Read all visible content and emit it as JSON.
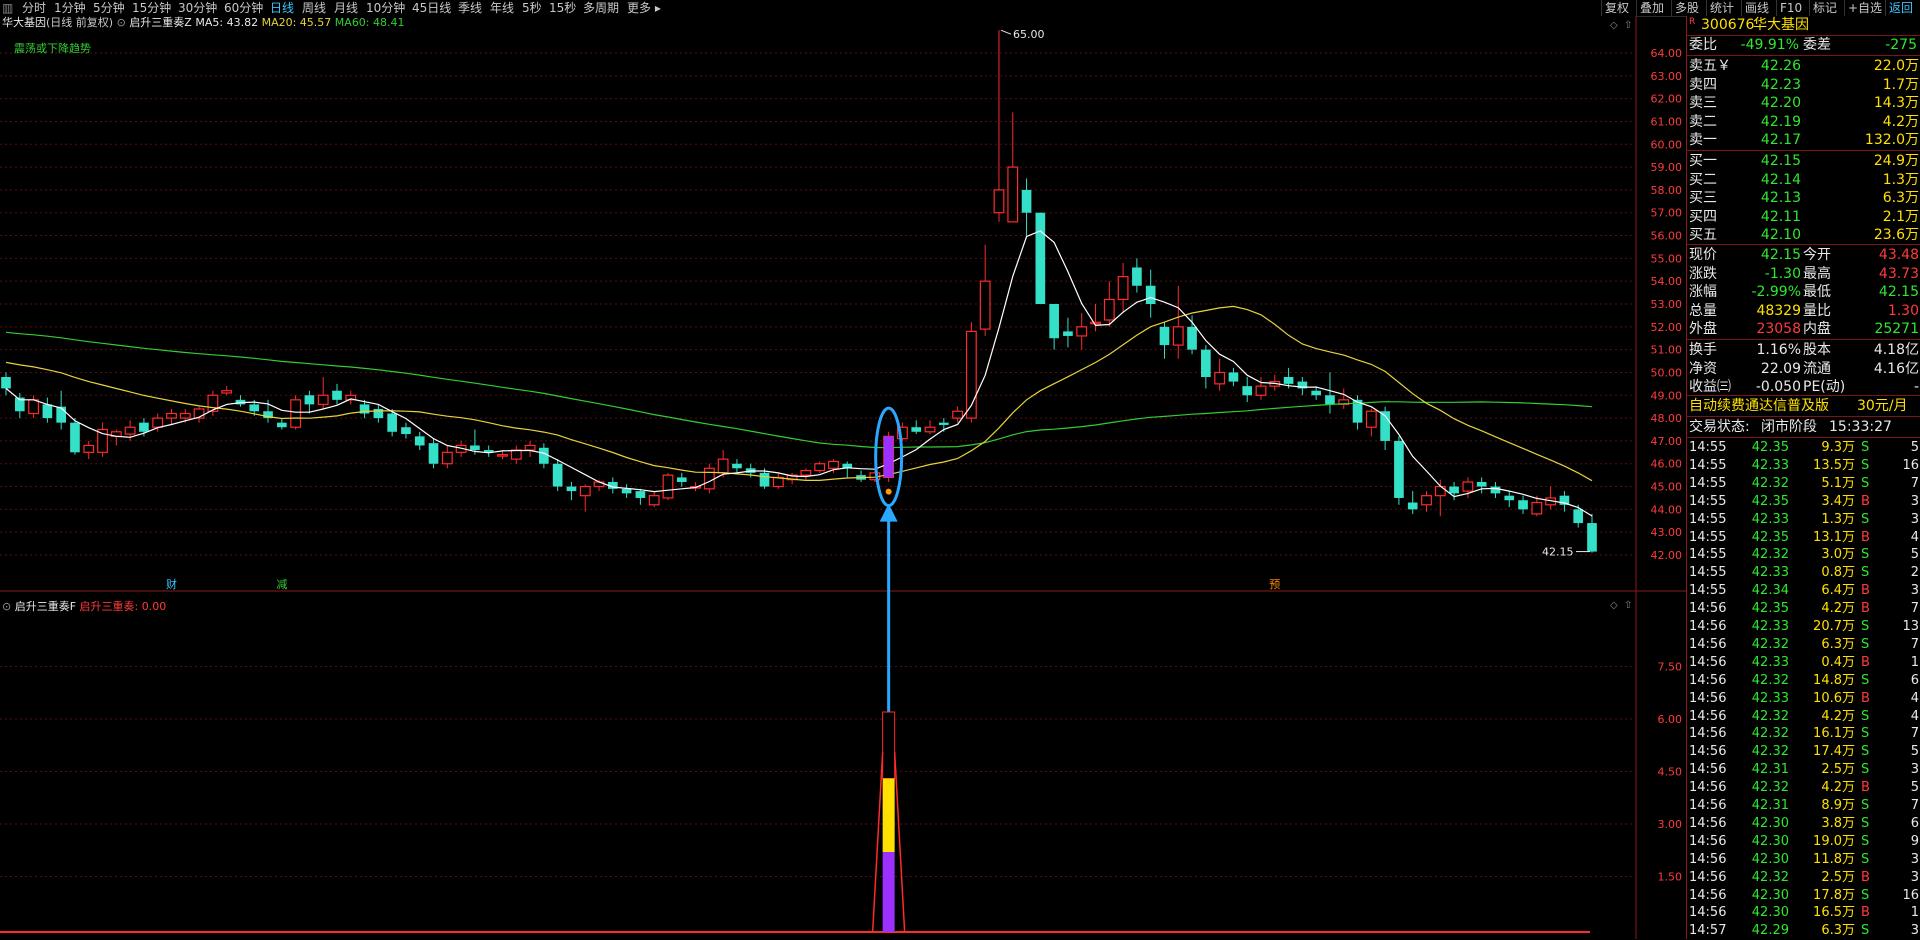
{
  "toolbar": {
    "left_items": [
      {
        "label": "分时",
        "active": false
      },
      {
        "label": "1分钟",
        "active": false
      },
      {
        "label": "5分钟",
        "active": false
      },
      {
        "label": "15分钟",
        "active": false
      },
      {
        "label": "30分钟",
        "active": false
      },
      {
        "label": "60分钟",
        "active": false
      },
      {
        "label": "日线",
        "active": true
      },
      {
        "label": "周线",
        "active": false
      },
      {
        "label": "月线",
        "active": false
      },
      {
        "label": "10分钟",
        "active": false
      },
      {
        "label": "45日线",
        "active": false
      },
      {
        "label": "季线",
        "active": false
      },
      {
        "label": "年线",
        "active": false
      },
      {
        "label": "5秒",
        "active": false
      },
      {
        "label": "15秒",
        "active": false
      },
      {
        "label": "多周期",
        "active": false
      },
      {
        "label": "更多",
        "active": false
      }
    ],
    "right_items": [
      {
        "label": "复权"
      },
      {
        "label": "叠加"
      },
      {
        "label": "多股"
      },
      {
        "label": "统计"
      },
      {
        "label": "画线"
      },
      {
        "label": "F10"
      },
      {
        "label": "标记"
      },
      {
        "label": "+自选"
      },
      {
        "label": "返回"
      }
    ]
  },
  "chart_header": {
    "stock_name": "华大基因",
    "period_label": "(日线 前复权)",
    "indicator_name": "启升三重奏Z",
    "ma5": "MA5: 43.82",
    "ma20": "MA20: 45.57",
    "ma60": "MA60: 48.41",
    "trend_text": "震荡或下降趋势",
    "max_label": "65.00",
    "last_label": "42.15",
    "markers": [
      "财",
      "减",
      "预"
    ]
  },
  "sub_header": {
    "indicator_name": "启升三重奏F",
    "indicator_value": "启升三重奏: 0.00"
  },
  "colors": {
    "up": "#ff2a2a",
    "down": "#35e0c8",
    "ma5": "#ffffff",
    "ma20": "#e6d23c",
    "ma60": "#33cc33",
    "grid": "#5a0f0f",
    "annotation": "#2aa8ff"
  },
  "chart_data": {
    "type": "candlestick",
    "price_axis": {
      "min": 42.0,
      "max": 64.0,
      "ticks": [
        "64.00",
        "63.00",
        "62.00",
        "61.00",
        "60.00",
        "59.00",
        "58.00",
        "57.00",
        "56.00",
        "55.00",
        "54.00",
        "53.00",
        "52.00",
        "51.00",
        "50.00",
        "49.00",
        "48.00",
        "47.00",
        "46.00",
        "45.00",
        "44.00",
        "43.00",
        "42.00"
      ]
    },
    "candles": [
      [
        49.8,
        49.3,
        50.0,
        49.0
      ],
      [
        48.9,
        48.3,
        49.1,
        48.0
      ],
      [
        48.2,
        48.8,
        49.0,
        48.0
      ],
      [
        48.6,
        48.0,
        48.9,
        47.8
      ],
      [
        48.5,
        47.8,
        49.2,
        47.5
      ],
      [
        47.8,
        46.5,
        48.0,
        46.4
      ],
      [
        46.5,
        46.8,
        47.0,
        46.2
      ],
      [
        46.5,
        47.5,
        47.8,
        46.3
      ],
      [
        47.2,
        47.4,
        47.5,
        46.8
      ],
      [
        47.3,
        47.6,
        47.9,
        47.0
      ],
      [
        47.8,
        47.4,
        48.0,
        47.2
      ],
      [
        47.6,
        48.0,
        48.2,
        47.4
      ],
      [
        48.0,
        48.2,
        48.4,
        47.7
      ],
      [
        48.0,
        48.2,
        48.4,
        47.8
      ],
      [
        48.0,
        48.4,
        48.5,
        47.8
      ],
      [
        48.3,
        49.0,
        49.2,
        48.1
      ],
      [
        49.1,
        49.2,
        49.4,
        49.0
      ],
      [
        48.8,
        48.6,
        49.0,
        48.5
      ],
      [
        48.6,
        48.3,
        48.8,
        48.1
      ],
      [
        48.3,
        48.0,
        48.8,
        47.8
      ],
      [
        47.8,
        47.6,
        48.0,
        47.5
      ],
      [
        47.6,
        48.8,
        49.0,
        47.5
      ],
      [
        49.0,
        48.6,
        49.2,
        48.2
      ],
      [
        48.6,
        49.0,
        49.8,
        48.4
      ],
      [
        49.2,
        48.8,
        49.5,
        48.6
      ],
      [
        48.8,
        49.0,
        49.2,
        48.6
      ],
      [
        48.6,
        48.2,
        48.8,
        48.0
      ],
      [
        48.4,
        48.0,
        48.6,
        47.8
      ],
      [
        48.2,
        47.4,
        48.4,
        47.2
      ],
      [
        47.6,
        47.3,
        47.8,
        47.1
      ],
      [
        47.2,
        46.8,
        47.4,
        46.6
      ],
      [
        46.9,
        46.0,
        47.1,
        45.8
      ],
      [
        46.0,
        46.5,
        46.8,
        45.8
      ],
      [
        46.5,
        46.8,
        47.0,
        46.3
      ],
      [
        46.8,
        46.6,
        47.5,
        46.4
      ],
      [
        46.6,
        46.5,
        46.8,
        46.3
      ],
      [
        46.4,
        46.4,
        46.6,
        46.2
      ],
      [
        46.2,
        46.6,
        46.8,
        46.0
      ],
      [
        46.6,
        46.8,
        47.0,
        46.3
      ],
      [
        46.7,
        46.0,
        46.9,
        45.8
      ],
      [
        46.0,
        45.0,
        46.2,
        44.8
      ],
      [
        45.0,
        44.8,
        45.2,
        44.4
      ],
      [
        44.6,
        45.0,
        45.1,
        43.9
      ],
      [
        45.0,
        45.2,
        45.3,
        44.8
      ],
      [
        45.2,
        44.9,
        45.4,
        44.7
      ],
      [
        44.9,
        44.7,
        45.1,
        44.5
      ],
      [
        44.8,
        44.5,
        44.9,
        44.2
      ],
      [
        44.2,
        44.6,
        44.8,
        44.1
      ],
      [
        44.5,
        45.5,
        45.6,
        44.4
      ],
      [
        45.4,
        45.2,
        45.6,
        45.0
      ],
      [
        45.0,
        45.0,
        45.2,
        44.8
      ],
      [
        44.9,
        45.8,
        46.0,
        44.7
      ],
      [
        45.6,
        46.2,
        46.6,
        45.4
      ],
      [
        46.0,
        45.8,
        46.2,
        45.6
      ],
      [
        45.8,
        45.6,
        46.0,
        45.4
      ],
      [
        45.6,
        45.0,
        45.8,
        44.9
      ],
      [
        45.0,
        45.4,
        45.6,
        44.9
      ],
      [
        45.3,
        45.5,
        45.6,
        45.1
      ],
      [
        45.5,
        45.7,
        45.8,
        45.3
      ],
      [
        45.7,
        46.0,
        46.1,
        45.6
      ],
      [
        45.8,
        46.1,
        46.2,
        45.6
      ],
      [
        46.0,
        45.8,
        46.1,
        45.4
      ],
      [
        45.5,
        45.3,
        45.7,
        45.2
      ],
      [
        45.3,
        45.6,
        45.7,
        45.2
      ],
      [
        45.4,
        47.2,
        47.4,
        45.2
      ],
      [
        47.1,
        47.6,
        47.8,
        47.0
      ],
      [
        47.6,
        47.4,
        47.9,
        47.3
      ],
      [
        47.4,
        47.6,
        47.9,
        47.3
      ],
      [
        47.8,
        47.7,
        48.0,
        47.4
      ],
      [
        48.0,
        48.3,
        48.5,
        47.8
      ],
      [
        48.0,
        51.8,
        52.2,
        47.8
      ],
      [
        51.9,
        54.0,
        55.6,
        51.6
      ],
      [
        57.0,
        58.0,
        65.0,
        56.6
      ],
      [
        56.6,
        59.0,
        61.4,
        56.6
      ],
      [
        58.0,
        57.0,
        58.5,
        56.0
      ],
      [
        57.0,
        53.0,
        57.0,
        53.0
      ],
      [
        53.0,
        51.5,
        53.0,
        51.0
      ],
      [
        51.8,
        51.6,
        52.4,
        51.1
      ],
      [
        51.6,
        52.0,
        52.6,
        51.0
      ],
      [
        52.2,
        52.2,
        53.0,
        51.8
      ],
      [
        52.3,
        53.2,
        54.0,
        52.0
      ],
      [
        53.2,
        54.2,
        54.8,
        52.6
      ],
      [
        54.6,
        53.8,
        55.0,
        53.5
      ],
      [
        53.8,
        53.0,
        54.5,
        52.4
      ],
      [
        52.0,
        51.2,
        52.2,
        50.6
      ],
      [
        51.2,
        52.0,
        53.8,
        50.6
      ],
      [
        52.0,
        51.0,
        52.5,
        50.8
      ],
      [
        51.0,
        49.8,
        51.2,
        49.3
      ],
      [
        49.5,
        50.0,
        50.6,
        49.2
      ],
      [
        50.0,
        49.6,
        50.2,
        49.4
      ],
      [
        49.4,
        49.0,
        49.8,
        48.7
      ],
      [
        49.0,
        49.4,
        49.8,
        48.8
      ],
      [
        49.4,
        49.6,
        49.9,
        49.2
      ],
      [
        49.8,
        49.5,
        50.2,
        49.3
      ],
      [
        49.6,
        49.3,
        49.8,
        49.0
      ],
      [
        49.2,
        49.0,
        49.4,
        48.8
      ],
      [
        49.0,
        48.6,
        50.0,
        48.2
      ],
      [
        48.6,
        48.8,
        49.3,
        48.4
      ],
      [
        48.8,
        47.8,
        49.0,
        47.5
      ],
      [
        47.6,
        48.3,
        48.4,
        47.2
      ],
      [
        48.3,
        47.0,
        48.5,
        46.6
      ],
      [
        47.0,
        44.5,
        47.2,
        44.2
      ],
      [
        44.3,
        44.0,
        44.8,
        43.8
      ],
      [
        44.2,
        44.6,
        44.8,
        43.9
      ],
      [
        44.6,
        45.0,
        45.3,
        43.7
      ],
      [
        45.0,
        44.7,
        45.2,
        44.4
      ],
      [
        44.8,
        45.2,
        45.4,
        44.5
      ],
      [
        45.2,
        45.0,
        45.4,
        44.7
      ],
      [
        45.0,
        44.7,
        45.2,
        44.5
      ],
      [
        44.6,
        44.4,
        44.8,
        44.1
      ],
      [
        44.4,
        44.0,
        44.6,
        43.8
      ],
      [
        43.8,
        44.3,
        44.6,
        43.7
      ],
      [
        44.2,
        44.5,
        45.0,
        44.0
      ],
      [
        44.6,
        44.2,
        44.8,
        43.9
      ],
      [
        44.0,
        43.4,
        44.2,
        43.2
      ],
      [
        43.4,
        42.15,
        43.8,
        42.1
      ]
    ],
    "sub_axis": {
      "ticks": [
        "7.50",
        "6.00",
        "4.50",
        "3.00",
        "1.50"
      ],
      "min": 0,
      "max": 9.0
    },
    "signal": {
      "candle_index": 64,
      "value_total": 6.2,
      "value_yellow": 4.3,
      "value_purple": 2.2
    }
  },
  "right_panel": {
    "code": "300676",
    "name": "华大基因",
    "rsi_tag": "R",
    "weibi": {
      "label": "委比",
      "value": "-49.91%",
      "label2": "委差",
      "value2": "-275"
    },
    "sell": [
      {
        "label": "卖五￥",
        "price": "42.26",
        "vol": "22.0万"
      },
      {
        "label": "卖四",
        "price": "42.23",
        "vol": "1.7万"
      },
      {
        "label": "卖三",
        "price": "42.20",
        "vol": "14.3万"
      },
      {
        "label": "卖二",
        "price": "42.19",
        "vol": "4.2万"
      },
      {
        "label": "卖一",
        "price": "42.17",
        "vol": "132.0万"
      }
    ],
    "buy": [
      {
        "label": "买一",
        "price": "42.15",
        "vol": "24.9万"
      },
      {
        "label": "买二",
        "price": "42.14",
        "vol": "1.3万"
      },
      {
        "label": "买三",
        "price": "42.13",
        "vol": "6.3万"
      },
      {
        "label": "买四",
        "price": "42.11",
        "vol": "2.1万"
      },
      {
        "label": "买五",
        "price": "42.10",
        "vol": "23.6万"
      }
    ],
    "quote": [
      {
        "l1": "现价",
        "v1": "42.15",
        "c1": "green",
        "l2": "今开",
        "v2": "43.48",
        "c2": "red"
      },
      {
        "l1": "涨跌",
        "v1": "-1.30",
        "c1": "green",
        "l2": "最高",
        "v2": "43.73",
        "c2": "red"
      },
      {
        "l1": "涨幅",
        "v1": "-2.99%",
        "c1": "green",
        "l2": "最低",
        "v2": "42.15",
        "c2": "green"
      },
      {
        "l1": "总量",
        "v1": "48329",
        "c1": "yellow",
        "l2": "量比",
        "v2": "1.30",
        "c2": "red"
      },
      {
        "l1": "外盘",
        "v1": "23058",
        "c1": "red",
        "l2": "内盘",
        "v2": "25271",
        "c2": "green"
      }
    ],
    "fund": [
      {
        "l1": "换手",
        "v1": "1.16%",
        "l2": "股本",
        "v2": "4.18亿"
      },
      {
        "l1": "净资",
        "v1": "22.09",
        "l2": "流通",
        "v2": "4.16亿"
      },
      {
        "l1": "收益㈢",
        "v1": "-0.050",
        "l2": "PE(动)",
        "v2": "-"
      }
    ],
    "promo": {
      "text": "自动续费通达信普及版",
      "price": "30元/月"
    },
    "status": {
      "label": "交易状态:",
      "value": "闭市阶段",
      "time": "15:33:27"
    },
    "ticks": [
      [
        "14:55",
        "42.35",
        "9.3万",
        "S",
        "5"
      ],
      [
        "14:55",
        "42.33",
        "13.5万",
        "S",
        "16"
      ],
      [
        "14:55",
        "42.32",
        "5.1万",
        "S",
        "7"
      ],
      [
        "14:55",
        "42.35",
        "3.4万",
        "B",
        "3"
      ],
      [
        "14:55",
        "42.33",
        "1.3万",
        "S",
        "3"
      ],
      [
        "14:55",
        "42.35",
        "13.1万",
        "B",
        "4"
      ],
      [
        "14:55",
        "42.32",
        "3.0万",
        "S",
        "5"
      ],
      [
        "14:55",
        "42.33",
        "0.8万",
        "S",
        "2"
      ],
      [
        "14:55",
        "42.34",
        "6.4万",
        "B",
        "3"
      ],
      [
        "14:56",
        "42.35",
        "4.2万",
        "B",
        "7"
      ],
      [
        "14:56",
        "42.33",
        "20.7万",
        "S",
        "13"
      ],
      [
        "14:56",
        "42.32",
        "6.3万",
        "S",
        "7"
      ],
      [
        "14:56",
        "42.33",
        "0.4万",
        "B",
        "1"
      ],
      [
        "14:56",
        "42.32",
        "14.8万",
        "S",
        "6"
      ],
      [
        "14:56",
        "42.33",
        "10.6万",
        "B",
        "4"
      ],
      [
        "14:56",
        "42.32",
        "4.2万",
        "S",
        "4"
      ],
      [
        "14:56",
        "42.32",
        "16.1万",
        "S",
        "7"
      ],
      [
        "14:56",
        "42.32",
        "17.4万",
        "S",
        "5"
      ],
      [
        "14:56",
        "42.31",
        "2.5万",
        "S",
        "3"
      ],
      [
        "14:56",
        "42.32",
        "4.2万",
        "B",
        "5"
      ],
      [
        "14:56",
        "42.31",
        "8.9万",
        "S",
        "7"
      ],
      [
        "14:56",
        "42.30",
        "3.8万",
        "S",
        "6"
      ],
      [
        "14:56",
        "42.30",
        "19.0万",
        "S",
        "9"
      ],
      [
        "14:56",
        "42.30",
        "11.8万",
        "S",
        "3"
      ],
      [
        "14:56",
        "42.32",
        "2.5万",
        "B",
        "3"
      ],
      [
        "14:56",
        "42.30",
        "17.8万",
        "S",
        "16"
      ],
      [
        "14:56",
        "42.30",
        "16.5万",
        "B",
        "1"
      ],
      [
        "14:57",
        "42.29",
        "6.3万",
        "S",
        "3"
      ]
    ]
  }
}
